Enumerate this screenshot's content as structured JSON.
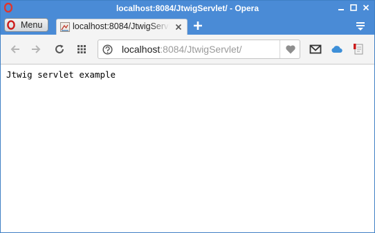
{
  "window": {
    "title": "localhost:8084/JtwigServlet/ - Opera"
  },
  "menu": {
    "label": "Menu"
  },
  "tab": {
    "title": "localhost:8084/JtwigServlet/"
  },
  "address": {
    "host": "localhost",
    "rest": ":8084/JtwigServlet/"
  },
  "page": {
    "text": "Jtwig servlet example"
  },
  "colors": {
    "titlebar": "#4a8bd6",
    "opera_red": "#cc1b1b",
    "toolbar": "#f4f4f4",
    "vk_blue": "#3d8fd8"
  },
  "icons": {
    "window": [
      "opera-logo-icon",
      "minimize-icon",
      "maximize-icon",
      "close-icon"
    ],
    "tabbar": [
      "opera-logo-icon",
      "page-favicon-icon",
      "tab-close-icon",
      "plus-icon",
      "tab-menu-icon"
    ],
    "toolbar": [
      "back-arrow-icon",
      "forward-arrow-icon",
      "reload-icon",
      "speed-dial-grid-icon",
      "site-info-icon",
      "heart-icon",
      "mail-icon",
      "cloud-icon",
      "notes-icon"
    ]
  }
}
